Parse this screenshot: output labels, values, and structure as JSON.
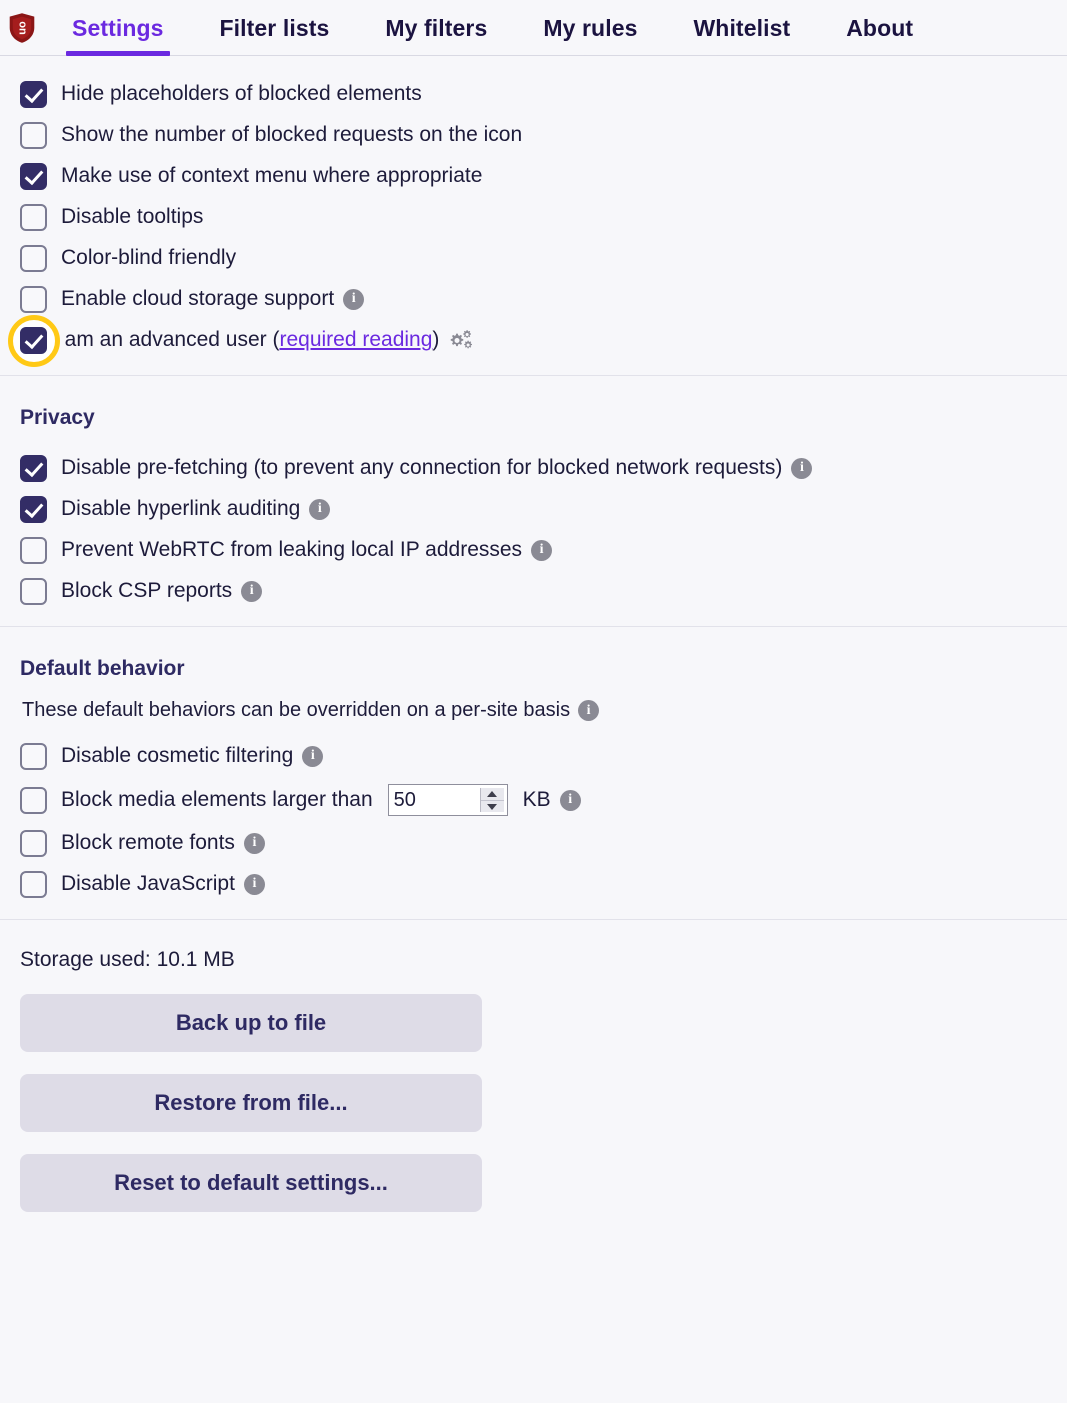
{
  "app": {
    "logo_icon": "ublock-origin-shield-icon",
    "logo_text": "uo",
    "logo_color": "#8b1616"
  },
  "theme": {
    "accent": "#6b29e0",
    "checkbox_on": "#332d66",
    "highlight_ring": "#ffc916",
    "button_bg": "#dedce7",
    "text": "#1d1b3a"
  },
  "tabs": [
    {
      "label": "Settings",
      "active": true
    },
    {
      "label": "Filter lists",
      "active": false
    },
    {
      "label": "My filters",
      "active": false
    },
    {
      "label": "My rules",
      "active": false
    },
    {
      "label": "Whitelist",
      "active": false
    },
    {
      "label": "About",
      "active": false
    }
  ],
  "general": {
    "options": [
      {
        "label": "Hide placeholders of blocked elements",
        "checked": true,
        "info": false
      },
      {
        "label": "Show the number of blocked requests on the icon",
        "checked": false,
        "info": false
      },
      {
        "label": "Make use of context menu where appropriate",
        "checked": true,
        "info": false
      },
      {
        "label": "Disable tooltips",
        "checked": false,
        "info": false
      },
      {
        "label": "Color-blind friendly",
        "checked": false,
        "info": false
      },
      {
        "label": "Enable cloud storage support",
        "checked": false,
        "info": true
      }
    ],
    "advanced_user": {
      "label_before": "I am an advanced user (",
      "link_label": "required reading",
      "label_after": ")",
      "checked": true,
      "highlighted": true,
      "gears_icon": "gears-icon"
    }
  },
  "privacy": {
    "title": "Privacy",
    "options": [
      {
        "label": "Disable pre-fetching (to prevent any connection for blocked network requests)",
        "checked": true,
        "info": true
      },
      {
        "label": "Disable hyperlink auditing",
        "checked": true,
        "info": true
      },
      {
        "label": "Prevent WebRTC from leaking local IP addresses",
        "checked": false,
        "info": true
      },
      {
        "label": "Block CSP reports",
        "checked": false,
        "info": true
      }
    ]
  },
  "default_behavior": {
    "title": "Default behavior",
    "note": "These default behaviors can be overridden on a per-site basis",
    "note_info": true,
    "options": [
      {
        "label": "Disable cosmetic filtering",
        "checked": false,
        "info": true
      },
      {
        "label": "Block remote fonts",
        "checked": false,
        "info": true
      },
      {
        "label": "Disable JavaScript",
        "checked": false,
        "info": true
      }
    ],
    "media_row": {
      "label_before": "Block media elements larger than",
      "value": "50",
      "unit": "KB",
      "checked": false,
      "info": true
    }
  },
  "footer": {
    "storage_used": "Storage used: 10.1 MB",
    "buttons": [
      {
        "label": "Back up to file"
      },
      {
        "label": "Restore from file..."
      },
      {
        "label": "Reset to default settings..."
      }
    ]
  },
  "icons": {
    "info": "i"
  }
}
